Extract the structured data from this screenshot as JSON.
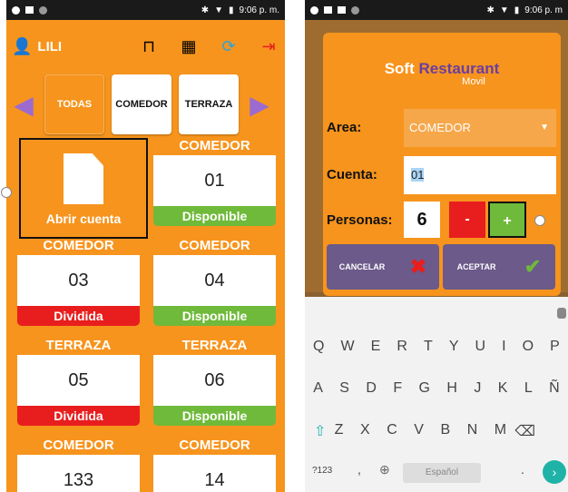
{
  "left": {
    "status_time": "9:06 p. m.",
    "user": "LILI",
    "areas": [
      "TODAS",
      "COMEDOR",
      "TERRAZA"
    ],
    "open_label": "Abrir cuenta",
    "tiles": [
      {
        "area": "COMEDOR",
        "number": "01",
        "status": "Disponible",
        "color": "green"
      },
      {
        "area": "COMEDOR",
        "number": "03",
        "status": "Dividida",
        "color": "red"
      },
      {
        "area": "COMEDOR",
        "number": "04",
        "status": "Disponible",
        "color": "green"
      },
      {
        "area": "TERRAZA",
        "number": "05",
        "status": "Dividida",
        "color": "red"
      },
      {
        "area": "TERRAZA",
        "number": "06",
        "status": "Disponible",
        "color": "green"
      },
      {
        "area": "COMEDOR",
        "number": "133",
        "status": "",
        "color": ""
      },
      {
        "area": "COMEDOR",
        "number": "14",
        "status": "",
        "color": ""
      }
    ],
    "colors": {
      "orange": "#f7941d",
      "green": "#6fba3a",
      "red": "#e81e1e",
      "purple": "#9c6bd0"
    }
  },
  "right": {
    "status_time": "9:06 p. m",
    "logo": {
      "soft": "Soft",
      "rest": "Restaurant",
      "movil": "Movil"
    },
    "area_label": "Area:",
    "area_value": "COMEDOR",
    "cuenta_label": "Cuenta:",
    "cuenta_value": "01",
    "personas_label": "Personas:",
    "personas_value": "6",
    "minus": "-",
    "plus": "+",
    "cancel": "CANCELAR",
    "accept": "ACEPTAR",
    "keyboard": {
      "row1": [
        "Q",
        "W",
        "E",
        "R",
        "T",
        "Y",
        "U",
        "I",
        "O",
        "P"
      ],
      "row2": [
        "A",
        "S",
        "D",
        "F",
        "G",
        "H",
        "J",
        "K",
        "L",
        "Ñ"
      ],
      "row3": [
        "Z",
        "X",
        "C",
        "V",
        "B",
        "N",
        "M"
      ],
      "row4_left": "?123",
      "comma": ",",
      "space": "Español",
      "period": "."
    }
  }
}
